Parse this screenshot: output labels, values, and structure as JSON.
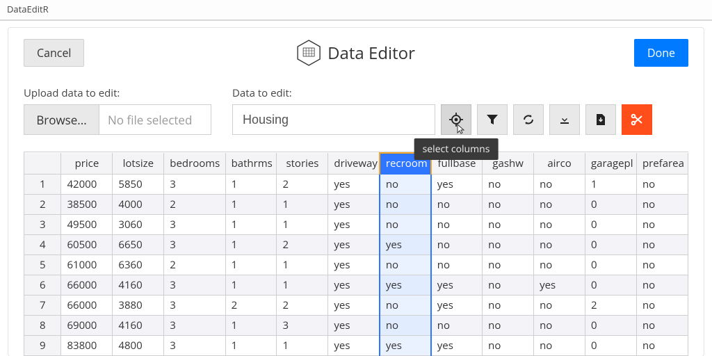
{
  "window": {
    "title": "DataEditR"
  },
  "header": {
    "cancel_label": "Cancel",
    "title": "Data Editor",
    "done_label": "Done",
    "logo_text": "DataEditR"
  },
  "controls": {
    "upload_label": "Upload data to edit:",
    "browse_label": "Browse...",
    "no_file_text": "No file selected",
    "data_label": "Data to edit:",
    "data_value": "Housing",
    "tooltip": "select columns",
    "icons": {
      "select_cols": "crosshair-icon",
      "filter": "filter-icon",
      "sync": "refresh-icon",
      "download": "download-icon",
      "save": "file-save-icon",
      "cut": "scissors-icon"
    }
  },
  "table": {
    "selected_col_index": 6,
    "columns": [
      "price",
      "lotsize",
      "bedrooms",
      "bathrms",
      "stories",
      "driveway",
      "recroom",
      "fullbase",
      "gashw",
      "airco",
      "garagepl",
      "prefarea"
    ],
    "rows": [
      {
        "n": "1",
        "price": "42000",
        "lotsize": "5850",
        "bedrooms": "3",
        "bathrms": "1",
        "stories": "2",
        "driveway": "yes",
        "recroom": "no",
        "fullbase": "yes",
        "gashw": "no",
        "airco": "no",
        "garagepl": "1",
        "prefarea": "no"
      },
      {
        "n": "2",
        "price": "38500",
        "lotsize": "4000",
        "bedrooms": "2",
        "bathrms": "1",
        "stories": "1",
        "driveway": "yes",
        "recroom": "no",
        "fullbase": "no",
        "gashw": "no",
        "airco": "no",
        "garagepl": "0",
        "prefarea": "no"
      },
      {
        "n": "3",
        "price": "49500",
        "lotsize": "3060",
        "bedrooms": "3",
        "bathrms": "1",
        "stories": "1",
        "driveway": "yes",
        "recroom": "no",
        "fullbase": "no",
        "gashw": "no",
        "airco": "no",
        "garagepl": "0",
        "prefarea": "no"
      },
      {
        "n": "4",
        "price": "60500",
        "lotsize": "6650",
        "bedrooms": "3",
        "bathrms": "1",
        "stories": "2",
        "driveway": "yes",
        "recroom": "yes",
        "fullbase": "no",
        "gashw": "no",
        "airco": "no",
        "garagepl": "0",
        "prefarea": "no"
      },
      {
        "n": "5",
        "price": "61000",
        "lotsize": "6360",
        "bedrooms": "2",
        "bathrms": "1",
        "stories": "1",
        "driveway": "yes",
        "recroom": "no",
        "fullbase": "no",
        "gashw": "no",
        "airco": "no",
        "garagepl": "0",
        "prefarea": "no"
      },
      {
        "n": "6",
        "price": "66000",
        "lotsize": "4160",
        "bedrooms": "3",
        "bathrms": "1",
        "stories": "1",
        "driveway": "yes",
        "recroom": "yes",
        "fullbase": "yes",
        "gashw": "no",
        "airco": "yes",
        "garagepl": "0",
        "prefarea": "no"
      },
      {
        "n": "7",
        "price": "66000",
        "lotsize": "3880",
        "bedrooms": "3",
        "bathrms": "2",
        "stories": "2",
        "driveway": "yes",
        "recroom": "no",
        "fullbase": "yes",
        "gashw": "no",
        "airco": "no",
        "garagepl": "2",
        "prefarea": "no"
      },
      {
        "n": "8",
        "price": "69000",
        "lotsize": "4160",
        "bedrooms": "3",
        "bathrms": "1",
        "stories": "3",
        "driveway": "yes",
        "recroom": "no",
        "fullbase": "no",
        "gashw": "no",
        "airco": "no",
        "garagepl": "0",
        "prefarea": "no"
      },
      {
        "n": "9",
        "price": "83800",
        "lotsize": "4800",
        "bedrooms": "3",
        "bathrms": "1",
        "stories": "1",
        "driveway": "yes",
        "recroom": "yes",
        "fullbase": "yes",
        "gashw": "no",
        "airco": "no",
        "garagepl": "0",
        "prefarea": "no"
      }
    ]
  }
}
